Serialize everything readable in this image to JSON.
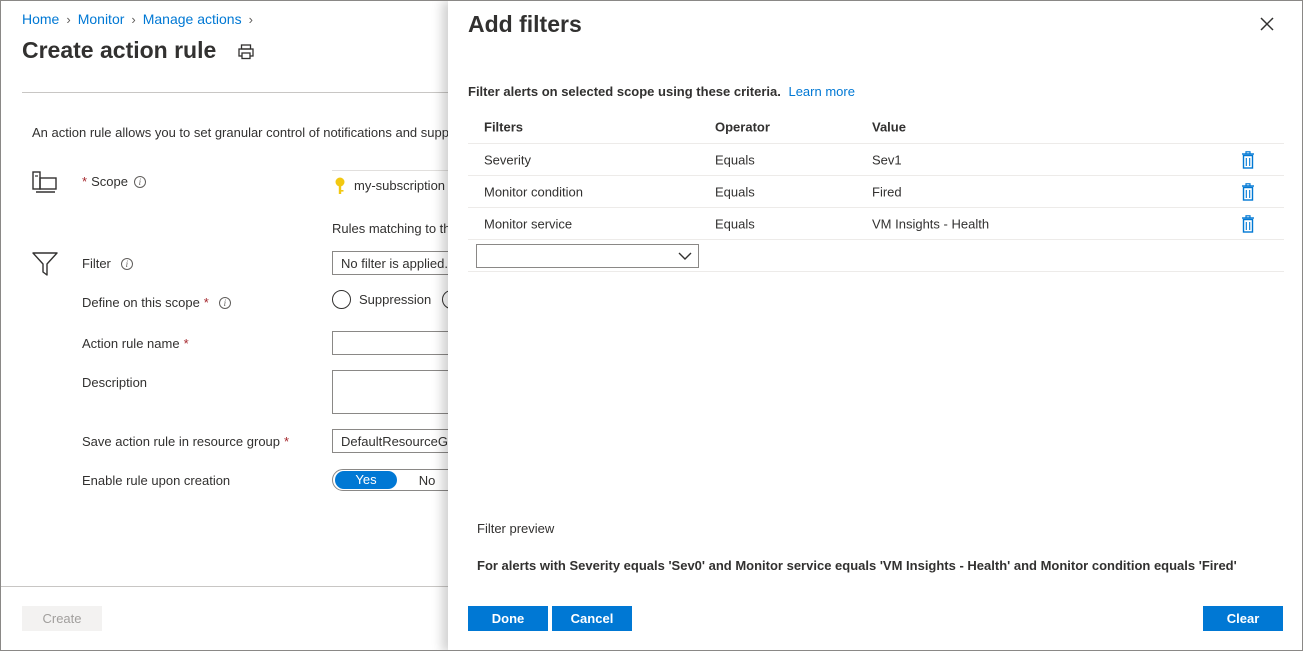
{
  "breadcrumb": [
    "Home",
    "Monitor",
    "Manage actions"
  ],
  "page_title": "Create action rule",
  "intro": "An action rule allows you to set granular control of notifications and supp",
  "form": {
    "scope_label": "Scope",
    "scope_value": "my-subscription",
    "rules_text": "Rules matching to th",
    "filter_label": "Filter",
    "filter_value": "No filter is applied.",
    "define_label": "Define on this scope",
    "suppression_label": "Suppression",
    "name_label": "Action rule name",
    "description_label": "Description",
    "resource_group_label": "Save action rule in resource group",
    "resource_group_value": "DefaultResourceGr",
    "enable_label": "Enable rule upon creation",
    "toggle_yes": "Yes",
    "toggle_no": "No",
    "required_mark": "*",
    "info_glyph": "i"
  },
  "create_button": "Create",
  "panel": {
    "title": "Add filters",
    "description": "Filter alerts on selected scope using these criteria.",
    "learn_more": "Learn more",
    "columns": [
      "Filters",
      "Operator",
      "Value"
    ],
    "rows": [
      {
        "filter": "Severity",
        "operator": "Equals",
        "value": "Sev1"
      },
      {
        "filter": "Monitor condition",
        "operator": "Equals",
        "value": "Fired"
      },
      {
        "filter": "Monitor service",
        "operator": "Equals",
        "value": "VM Insights - Health"
      }
    ],
    "preview_label": "Filter preview",
    "preview_text": "For alerts with Severity equals 'Sev0' and Monitor service equals 'VM Insights - Health' and Monitor condition equals 'Fired'",
    "done": "Done",
    "cancel": "Cancel",
    "clear": "Clear"
  },
  "colors": {
    "accent": "#0078d4",
    "required": "#a4262c"
  }
}
